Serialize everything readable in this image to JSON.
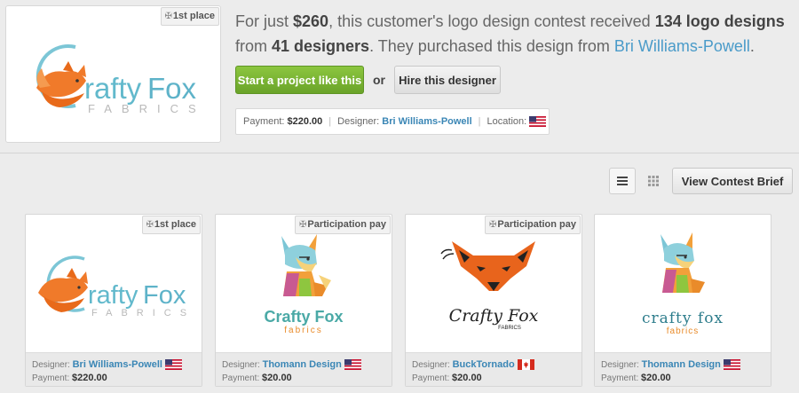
{
  "hero": {
    "badge": "1st place",
    "logo_word1": "rafty",
    "logo_word2": "Fox",
    "logo_sub": "FABRICS"
  },
  "summary": {
    "prefix": "For just ",
    "price": "$260",
    "mid1": ", this customer's logo design contest received ",
    "designs": "134 logo designs",
    "mid2": " from ",
    "designers": "41 designers",
    "mid3": ". They purchased this design from ",
    "designer_link": "Bri Williams-Powell",
    "suffix": "."
  },
  "actions": {
    "start_label": "Start a project like this",
    "or_label": "or",
    "hire_label": "Hire this designer"
  },
  "info": {
    "payment_label": "Payment:",
    "payment_value": "$220.00",
    "designer_label": "Designer:",
    "designer_value": "Bri Williams-Powell",
    "location_label": "Location:",
    "flag": "us-flag-icon"
  },
  "toolbar": {
    "list_icon": "list-view-icon",
    "grid_icon": "grid-view-icon",
    "brief_label": "View Contest Brief"
  },
  "cards": [
    {
      "badge": "1st place",
      "designer_label": "Designer:",
      "designer": "Bri Williams-Powell",
      "payment_label": "Payment:",
      "payment": "$220.00",
      "flag": "us-flag-icon",
      "logo_word1": "rafty",
      "logo_word2": "Fox",
      "logo_sub": "FABRICS"
    },
    {
      "badge": "Participation pay",
      "designer_label": "Designer:",
      "designer": "Thomann Design",
      "payment_label": "Payment:",
      "payment": "$20.00",
      "flag": "us-flag-icon",
      "logo_title": "Crafty Fox",
      "logo_sub": "fabrics"
    },
    {
      "badge": "Participation pay",
      "designer_label": "Designer:",
      "designer": "BuckTornado",
      "payment_label": "Payment:",
      "payment": "$20.00",
      "flag": "ca-flag-icon",
      "logo_title": "Crafty Fox",
      "logo_sub": "FABRICS"
    },
    {
      "designer_label": "Designer:",
      "designer": "Thomann Design",
      "payment_label": "Payment:",
      "payment": "$20.00",
      "flag": "us-flag-icon",
      "logo_title": "crafty fox",
      "logo_sub": "fabrics"
    }
  ]
}
